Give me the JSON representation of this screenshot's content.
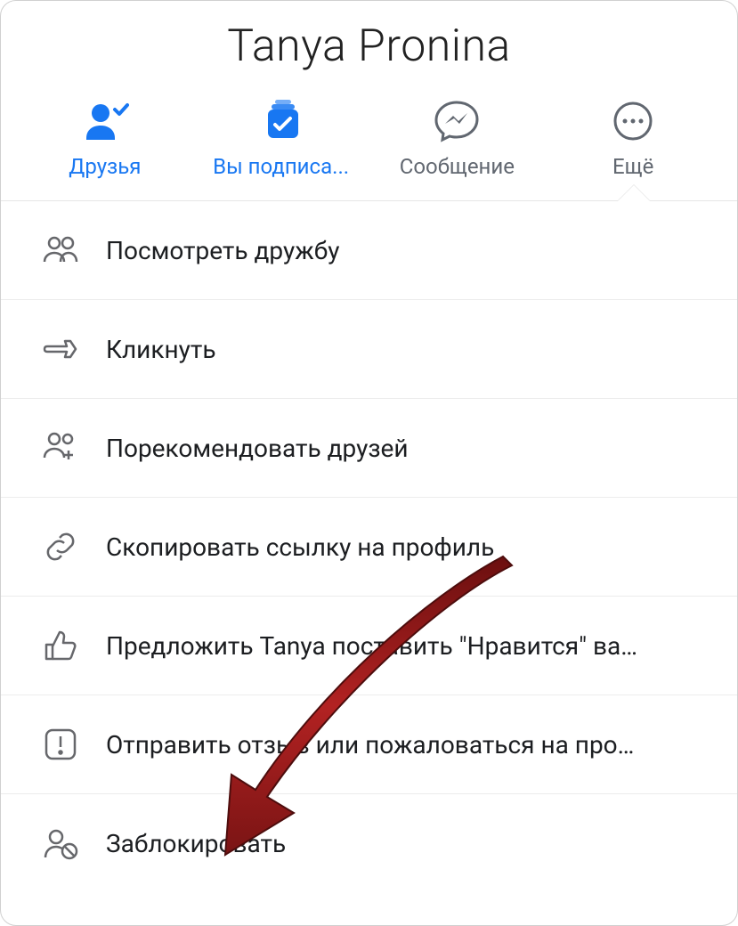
{
  "title": "Tanya Pronina",
  "tabs": {
    "friends": "Друзья",
    "subscribed": "Вы подписа...",
    "message": "Сообщение",
    "more": "Ещё"
  },
  "menu": {
    "view_friendship": "Посмотреть дружбу",
    "poke": "Кликнуть",
    "suggest_friends": "Порекомендовать друзей",
    "copy_link": "Скопировать ссылку на профиль",
    "suggest_like": "Предложить Tanya поставить \"Нравится\" ва…",
    "report": "Отправить отзыв или пожаловаться на про…",
    "block": "Заблокировать"
  },
  "colors": {
    "accent": "#1877f2",
    "icon_gray": "#616770",
    "arrow": "#a01818"
  }
}
